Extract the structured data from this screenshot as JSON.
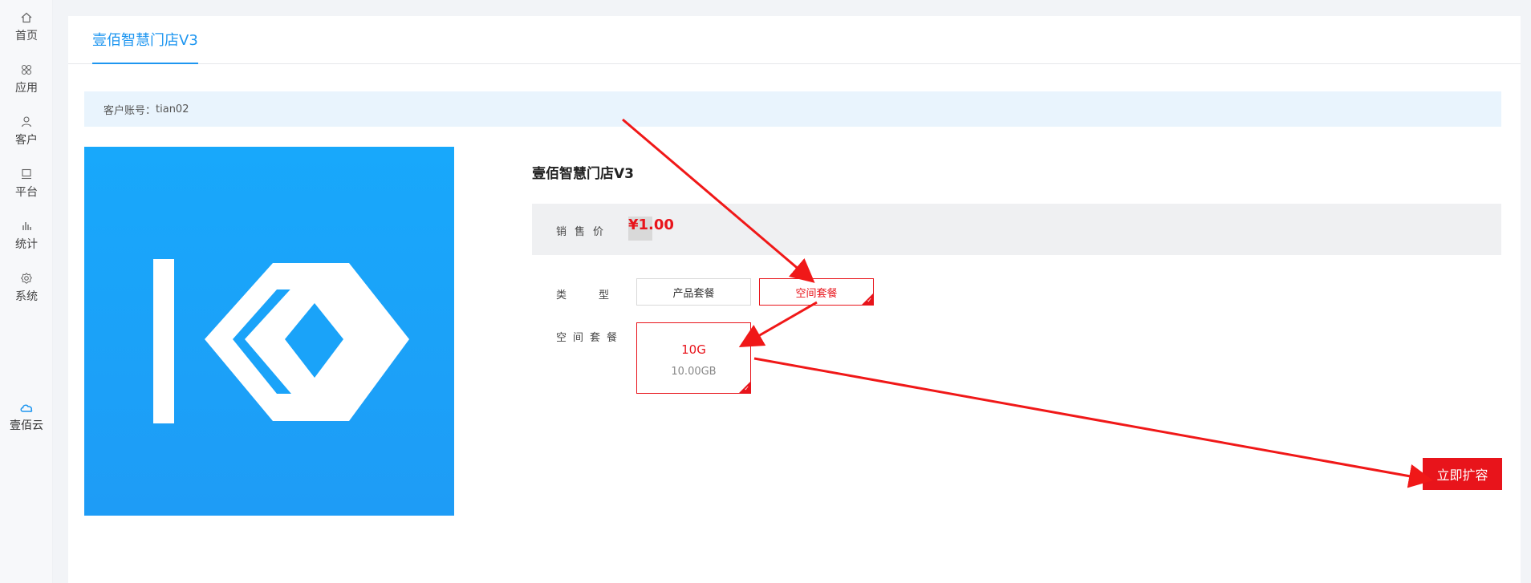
{
  "sidebar": {
    "items": [
      {
        "label": "首页",
        "icon": "home-icon"
      },
      {
        "label": "应用",
        "icon": "apps-icon"
      },
      {
        "label": "客户",
        "icon": "user-icon"
      },
      {
        "label": "平台",
        "icon": "monitor-icon"
      },
      {
        "label": "统计",
        "icon": "bar-chart-icon"
      },
      {
        "label": "系统",
        "icon": "gear-icon"
      }
    ],
    "cloud": {
      "label": "壹佰云",
      "icon": "cloud-icon"
    }
  },
  "tabs": {
    "active": "壹佰智慧门店V3"
  },
  "account": {
    "label": "客户账号：",
    "value": "tian02"
  },
  "product": {
    "title": "壹佰智慧门店V3",
    "price_label": "销售价",
    "price": "¥1.00"
  },
  "type_row": {
    "label": "类型",
    "options": [
      "产品套餐",
      "空间套餐"
    ],
    "selected": "空间套餐"
  },
  "space_row": {
    "label": "空间套餐",
    "package": {
      "name": "10G",
      "size": "10.00GB"
    }
  },
  "action": {
    "expand_label": "立即扩容"
  },
  "colors": {
    "accent": "#1e96f0",
    "danger": "#e8141b",
    "account_bg": "#e9f4fd"
  }
}
